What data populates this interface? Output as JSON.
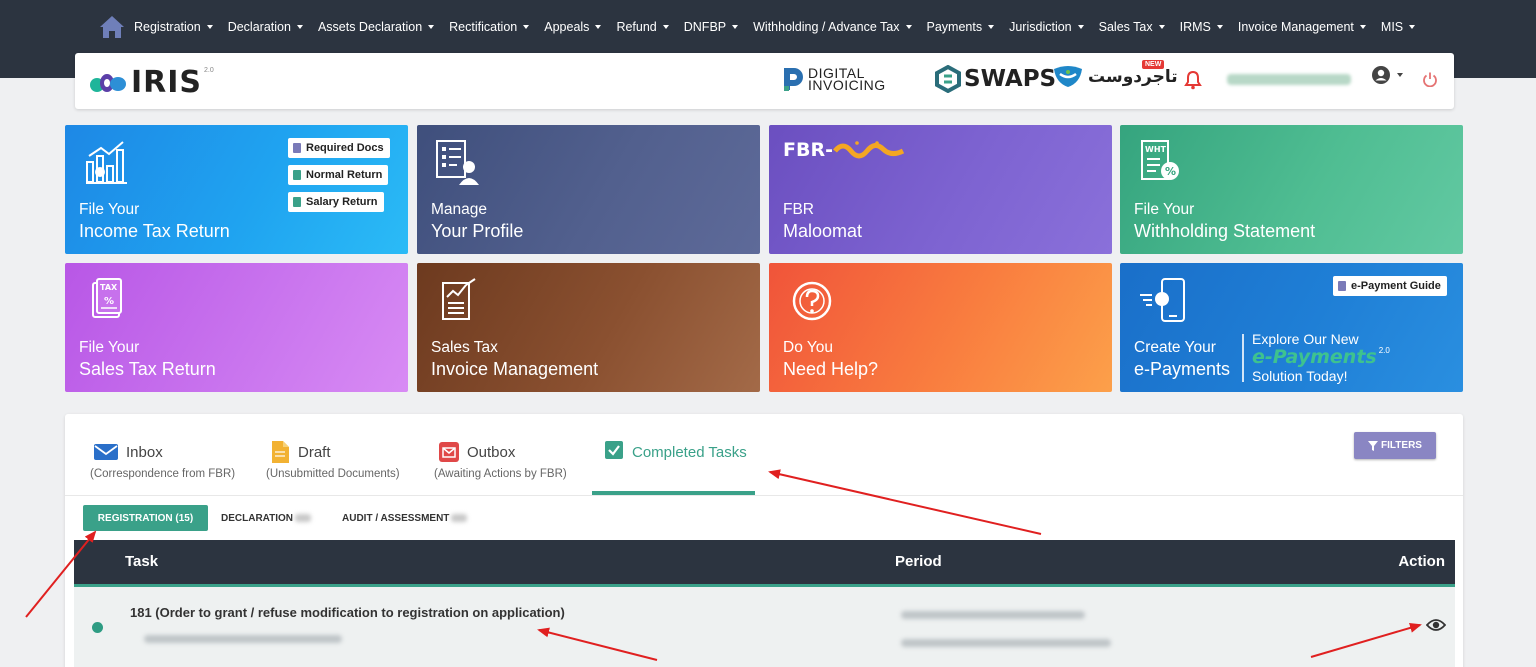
{
  "nav": {
    "home_icon": "home-icon",
    "items": [
      "Registration",
      "Declaration",
      "Assets Declaration",
      "Rectification",
      "Appeals",
      "Refund",
      "DNFBP",
      "Withholding / Advance Tax",
      "Payments",
      "Jurisdiction",
      "Sales Tax",
      "IRMS",
      "Invoice Management",
      "MIS"
    ]
  },
  "header": {
    "logo": "IRIS",
    "logo_version": "2.0",
    "digital_invoicing": [
      "DIGITAL",
      "INVOICING"
    ],
    "swaps": "SWAPS",
    "tajir_dost": "تاجردوست",
    "new_badge": "NEW"
  },
  "tiles": [
    {
      "line1": "File Your",
      "line2": "Income Tax Return"
    },
    {
      "line1": "Manage",
      "line2": "Your Profile"
    },
    {
      "line1": "FBR",
      "line2": "Maloomat",
      "banner": "FBR-"
    },
    {
      "line1": "File Your",
      "line2": "Withholding Statement"
    },
    {
      "line1": "File Your",
      "line2": "Sales Tax Return"
    },
    {
      "line1": "Sales Tax",
      "line2": "Invoice Management"
    },
    {
      "line1": "Do You",
      "line2": "Need Help?"
    },
    {
      "line1": "Create Your",
      "line2": "e-Payments"
    }
  ],
  "income_pills": [
    "Required Docs",
    "Normal Return",
    "Salary Return"
  ],
  "epay": {
    "guide": "e-Payment Guide",
    "explore1": "Explore Our New",
    "brand": "e-Payments",
    "brand_sup": "2.0",
    "explore2": "Solution Today!"
  },
  "tabs": [
    {
      "title": "Inbox",
      "sub": "(Correspondence from FBR)"
    },
    {
      "title": "Draft",
      "sub": "(Unsubmitted Documents)"
    },
    {
      "title": "Outbox",
      "sub": "(Awaiting Actions by FBR)"
    },
    {
      "title": "Completed Tasks",
      "sub": ""
    }
  ],
  "filters": "FILTERS",
  "subtabs": [
    "REGISTRATION (15)",
    "DECLARATION",
    "AUDIT / ASSESSMENT"
  ],
  "table": {
    "headers": [
      "Task",
      "Period",
      "Action"
    ],
    "rows": [
      {
        "task": "181 (Order to grant / refuse modification to registration on application)"
      }
    ]
  },
  "colors": {
    "nav_bg": "#2c3440",
    "accent_green": "#3aa189",
    "filters_btn": "#8a86c3"
  }
}
